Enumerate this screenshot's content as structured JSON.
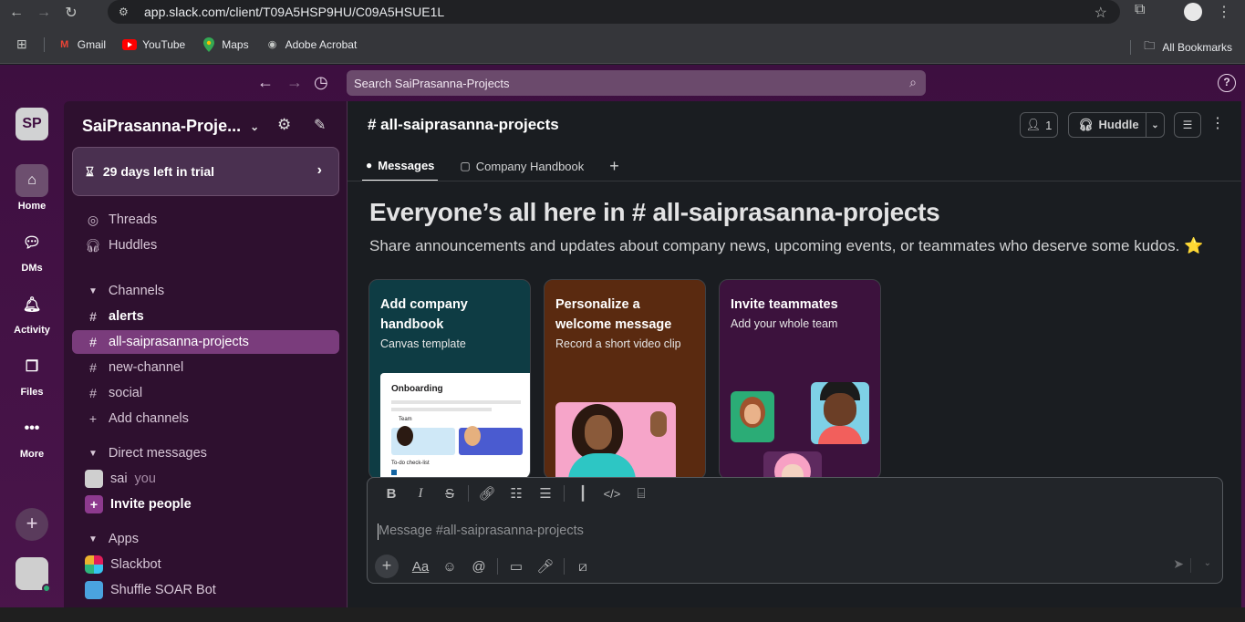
{
  "browser": {
    "url": "app.slack.com/client/T09A5HSP9HU/C09A5HSUE1L",
    "bookmarks": [
      {
        "label": "Gmail",
        "icon": "gmail-icon"
      },
      {
        "label": "YouTube",
        "icon": "youtube-icon"
      },
      {
        "label": "Maps",
        "icon": "maps-icon"
      },
      {
        "label": "Adobe Acrobat",
        "icon": "acrobat-icon"
      }
    ],
    "all_bookmarks": "All Bookmarks"
  },
  "slack": {
    "search_placeholder": "Search SaiPrasanna-Projects",
    "help": "?",
    "rail": {
      "workspace_initials": "SP",
      "items": [
        {
          "label": "Home",
          "icon": "home-icon"
        },
        {
          "label": "DMs",
          "icon": "dms-icon"
        },
        {
          "label": "Activity",
          "icon": "bell-icon"
        },
        {
          "label": "Files",
          "icon": "files-icon"
        },
        {
          "label": "More",
          "icon": "more-icon"
        }
      ]
    },
    "sidebar": {
      "workspace_name": "SaiPrasanna-Proje...",
      "trial": "29 days left in trial",
      "threads": "Threads",
      "huddles": "Huddles",
      "channels_header": "Channels",
      "channels": [
        "alerts",
        "all-saiprasanna-projects",
        "new-channel",
        "social"
      ],
      "add_channels": "Add channels",
      "dm_header": "Direct messages",
      "dm_user": "sai",
      "dm_you": "you",
      "invite": "Invite people",
      "apps_header": "Apps",
      "apps": [
        "Slackbot",
        "Shuffle SOAR Bot"
      ]
    },
    "main": {
      "channel_name": "# all-saiprasanna-projects",
      "member_count": "1",
      "huddle_label": "Huddle",
      "tabs": [
        "Messages",
        "Company Handbook"
      ],
      "tab_add": "+",
      "welcome_title": "Everyone’s all here in # all-saiprasanna-projects",
      "welcome_sub": "Share announcements and updates about company news, upcoming events, or teammates who deserve some kudos. ⭐",
      "cards": [
        {
          "title": "Add company handbook",
          "subtitle": "Canvas template",
          "mini_title": "Onboarding",
          "mini_team": "Team",
          "mini_todo": "To-do check-list"
        },
        {
          "title": "Personalize a welcome message",
          "subtitle": "Record a short video clip"
        },
        {
          "title": "Invite teammates",
          "subtitle": "Add your whole team"
        }
      ],
      "composer_placeholder": "Message #all-saiprasanna-projects"
    }
  },
  "colors": {
    "aubergine": "#3f0e40",
    "active_channel": "#7a3c7c",
    "card_teal": "#0e3c44",
    "card_brown": "#5a2a10",
    "card_purple": "#3c123d"
  }
}
